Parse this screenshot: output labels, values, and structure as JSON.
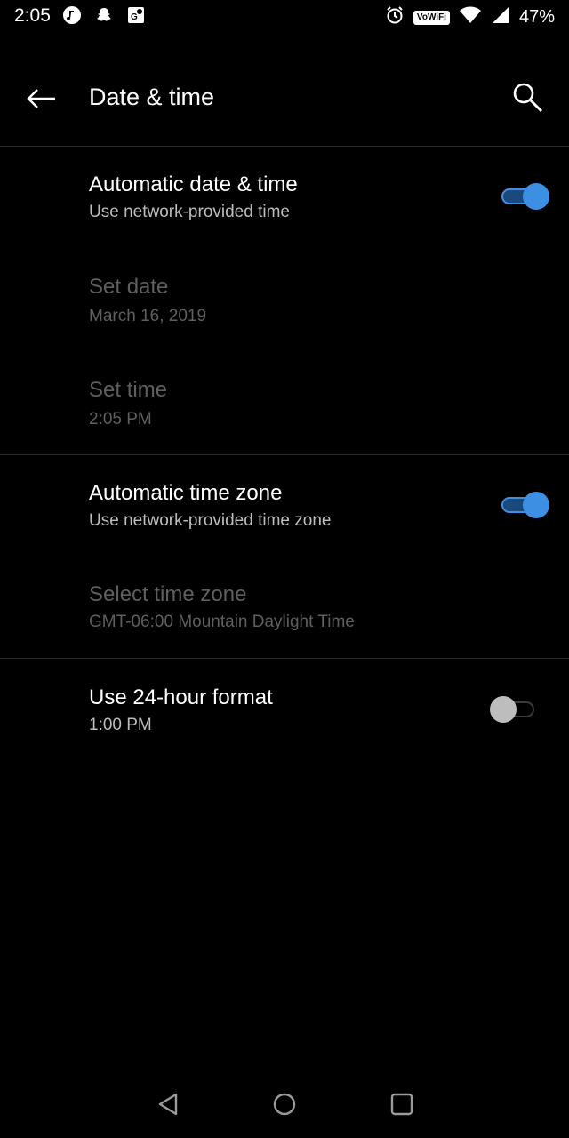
{
  "status_bar": {
    "time": "2:05",
    "left_icons": [
      "music-icon",
      "snapchat-icon",
      "maps-icon"
    ],
    "right_icons": [
      "alarm-icon",
      "vowifi-icon",
      "wifi-icon",
      "signal-icon"
    ],
    "vowifi_label": "VoWiFi",
    "battery": "47%"
  },
  "appbar": {
    "title": "Date & time"
  },
  "settings": [
    {
      "title": "Automatic date & time",
      "summary": "Use network-provided time",
      "switch": "on",
      "enabled": true
    },
    {
      "title": "Set date",
      "summary": "March 16, 2019",
      "enabled": false
    },
    {
      "title": "Set time",
      "summary": "2:05 PM",
      "enabled": false
    },
    {
      "title": "Automatic time zone",
      "summary": "Use network-provided time zone",
      "switch": "on",
      "enabled": true
    },
    {
      "title": "Select time zone",
      "summary": "GMT-06:00 Mountain Daylight Time",
      "enabled": false
    },
    {
      "title": "Use 24-hour format",
      "summary": "1:00 PM",
      "switch": "off",
      "enabled": true
    }
  ],
  "colors": {
    "accent": "#3d8fe3",
    "background": "#000000",
    "disabled_text": "#5f5f5f"
  },
  "navbar": [
    "back-nav-icon",
    "home-nav-icon",
    "recents-nav-icon"
  ]
}
